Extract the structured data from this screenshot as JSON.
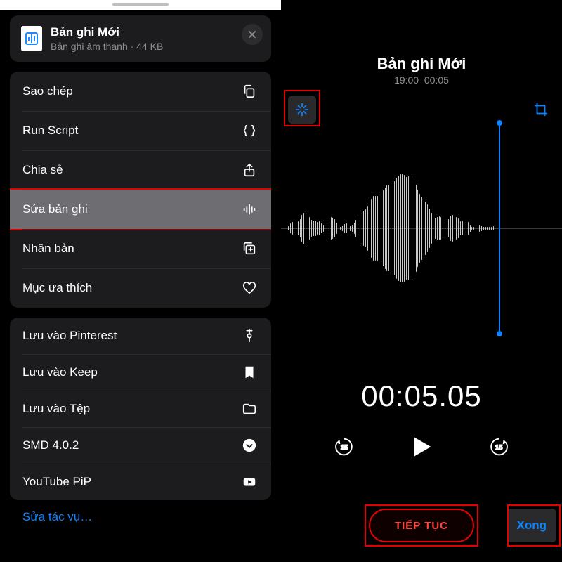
{
  "left": {
    "header": {
      "title": "Bản ghi Mới",
      "subtitle": "Bản ghi âm thanh · 44 KB"
    },
    "group1": [
      {
        "label": "Sao chép",
        "icon": "copy-icon"
      },
      {
        "label": "Run Script",
        "icon": "braces-icon"
      },
      {
        "label": "Chia sẻ",
        "icon": "share-icon"
      },
      {
        "label": "Sửa bản ghi",
        "icon": "waveform-icon",
        "highlighted": true
      },
      {
        "label": "Nhân bản",
        "icon": "duplicate-icon"
      },
      {
        "label": "Mục ưa thích",
        "icon": "heart-icon"
      }
    ],
    "group2": [
      {
        "label": "Lưu vào Pinterest",
        "icon": "pin-icon"
      },
      {
        "label": "Lưu vào Keep",
        "icon": "bookmark-icon"
      },
      {
        "label": "Lưu vào Tệp",
        "icon": "folder-icon"
      },
      {
        "label": "SMD 4.0.2",
        "icon": "chevron-circle-icon"
      },
      {
        "label": "YouTube PiP",
        "icon": "youtube-icon"
      }
    ],
    "edit_tasks_label": "Sửa tác vụ…"
  },
  "right": {
    "title": "Bản ghi Mới",
    "time_recorded": "19:00",
    "duration_short": "00:05",
    "big_time": "00:05.05",
    "skip_seconds": "15",
    "continue_label": "TIẾP TỤC",
    "done_label": "Xong"
  }
}
